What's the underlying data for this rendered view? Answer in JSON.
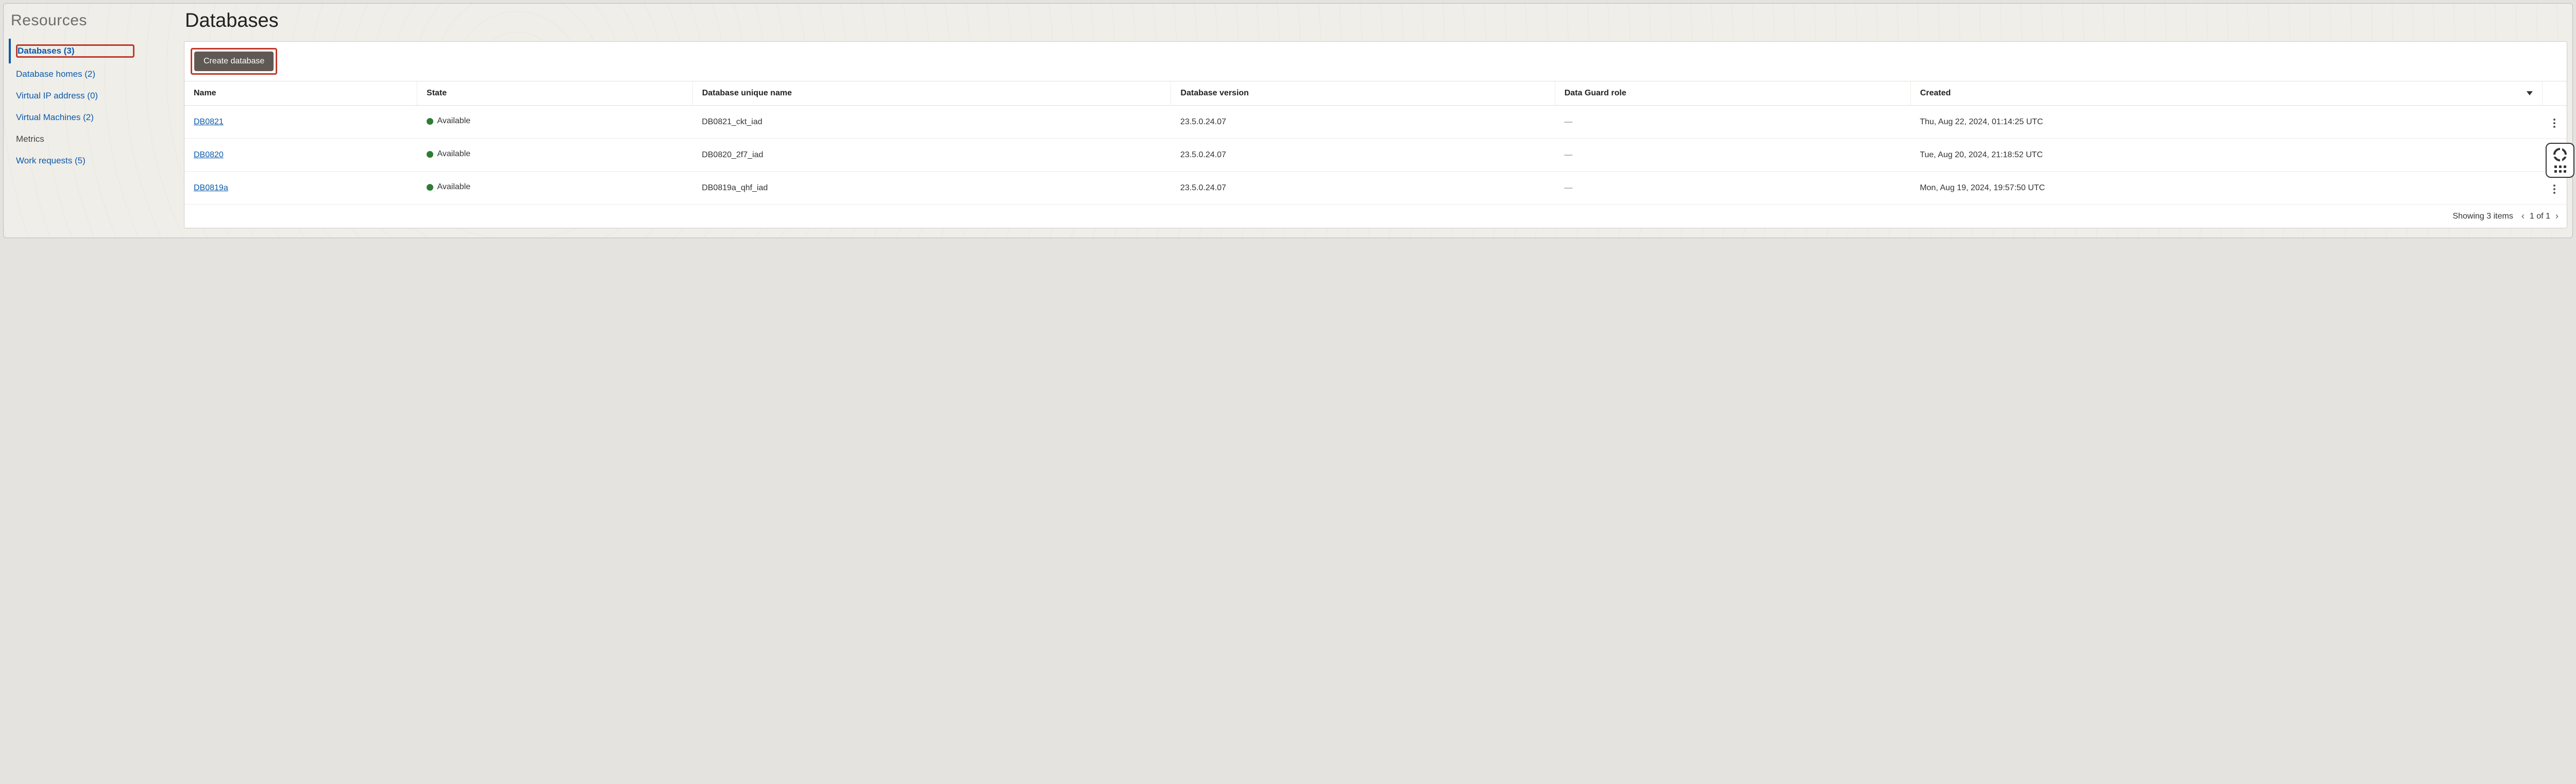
{
  "sidebar": {
    "title": "Resources",
    "items": [
      {
        "label": "Databases (3)",
        "active": true,
        "highlighted": true
      },
      {
        "label": "Database homes (2)"
      },
      {
        "label": "Virtual IP address (0)"
      },
      {
        "label": "Virtual Machines (2)"
      },
      {
        "label": "Metrics",
        "plain": true
      },
      {
        "label": "Work requests (5)"
      }
    ]
  },
  "page": {
    "title": "Databases",
    "create_button": "Create database"
  },
  "table": {
    "columns": {
      "name": "Name",
      "state": "State",
      "unique_name": "Database unique name",
      "version": "Database version",
      "dg_role": "Data Guard role",
      "created": "Created"
    },
    "rows": [
      {
        "name": "DB0821",
        "state": "Available",
        "unique_name": "DB0821_ckt_iad",
        "version": "23.5.0.24.07",
        "dg_role": "—",
        "created": "Thu, Aug 22, 2024, 01:14:25 UTC"
      },
      {
        "name": "DB0820",
        "state": "Available",
        "unique_name": "DB0820_2f7_iad",
        "version": "23.5.0.24.07",
        "dg_role": "—",
        "created": "Tue, Aug 20, 2024, 21:18:52 UTC"
      },
      {
        "name": "DB0819a",
        "state": "Available",
        "unique_name": "DB0819a_qhf_iad",
        "version": "23.5.0.24.07",
        "dg_role": "—",
        "created": "Mon, Aug 19, 2024, 19:57:50 UTC"
      }
    ]
  },
  "footer": {
    "showing": "Showing 3 items",
    "page": "1 of 1"
  }
}
